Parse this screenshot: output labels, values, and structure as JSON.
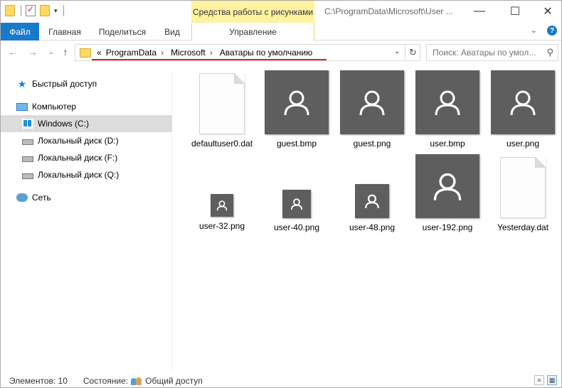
{
  "titlebar": {
    "context_tab_label": "Средства работы с рисунками",
    "window_title": "C:\\ProgramData\\Microsoft\\User ...",
    "minimize": "—",
    "maximize": "☐",
    "close": "✕"
  },
  "ribbon": {
    "tabs": [
      "Файл",
      "Главная",
      "Поделиться",
      "Вид",
      "Управление"
    ],
    "expand": "⌄",
    "help": "?"
  },
  "navbar": {
    "back": "←",
    "forward": "→",
    "recent": "⌄",
    "up": "↑",
    "breadcrumb": {
      "overflow": "«",
      "items": [
        "ProgramData",
        "Microsoft",
        "Аватары по умолчанию"
      ],
      "separator": "›"
    },
    "address_dropdown": "⌄",
    "refresh": "↻",
    "search_placeholder": "Поиск: Аватары по умол...",
    "search_icon": "⚲"
  },
  "sidebar": {
    "items": [
      {
        "label": "Быстрый доступ",
        "icon": "star-icon"
      },
      {
        "label": "Компьютер",
        "icon": "computer-icon"
      },
      {
        "label": "Windows (C:)",
        "icon": "windows-drive-icon",
        "selected": true
      },
      {
        "label": "Локальный диск (D:)",
        "icon": "drive-icon"
      },
      {
        "label": "Локальный диск (F:)",
        "icon": "drive-icon"
      },
      {
        "label": "Локальный диск (Q:)",
        "icon": "drive-icon"
      },
      {
        "label": "Сеть",
        "icon": "network-icon"
      }
    ]
  },
  "files": [
    {
      "name": "defaultuser0.dat",
      "kind": "document"
    },
    {
      "name": "guest.bmp",
      "kind": "avatar"
    },
    {
      "name": "guest.png",
      "kind": "avatar"
    },
    {
      "name": "user.bmp",
      "kind": "avatar"
    },
    {
      "name": "user.png",
      "kind": "avatar"
    },
    {
      "name": "user-32.png",
      "kind": "avatar"
    },
    {
      "name": "user-40.png",
      "kind": "avatar"
    },
    {
      "name": "user-48.png",
      "kind": "avatar"
    },
    {
      "name": "user-192.png",
      "kind": "avatar"
    },
    {
      "name": "Yesterday.dat",
      "kind": "document"
    }
  ],
  "status": {
    "items_count": "Элементов: 10",
    "state_label": "Состояние:",
    "state_value": "Общий доступ"
  },
  "colors": {
    "file_tab": "#1979ca",
    "context_tab": "#fff2a0",
    "thumb_bg": "#5e5e5e",
    "annotation_line": "#e21d1d"
  }
}
